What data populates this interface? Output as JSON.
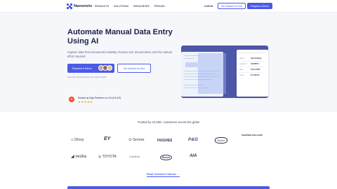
{
  "nav": {
    "brand": "Nanonets",
    "links": [
      "PRODUCTS",
      "SOLUTIONS",
      "RESOURCES",
      "PRICING"
    ],
    "login": "LOG IN",
    "free_button": "Get Started for Free",
    "demo_button": "Request a Demo"
  },
  "hero": {
    "title": "Automate Manual Data Entry Using AI",
    "subtitle": "Capture data from documents instantly. Reduce turn around times and the manual effort required.",
    "demo_button": "Request a Demo",
    "free_button": "Get started for free",
    "free_note": "Free trial. Cancel anytime. No setup charges.",
    "g2_badge": "G",
    "g2_rank": "Ranked as High-Performer on G2 (4.8 of 5)",
    "stars": "★★★★★"
  },
  "invoice_card": {
    "rows": [
      {
        "key": "Name",
        "value": "Jacob Wong"
      },
      {
        "key": "Invoice #",
        "value": "12478974"
      },
      {
        "key": "Date",
        "value": "01-01-2020"
      },
      {
        "key": "Total",
        "value": "$ 1,245.00"
      }
    ]
  },
  "trusted": {
    "heading": "Trusted by 10,000+ customers across the globe",
    "logos_row1": [
      "Divvy",
      "EY",
      "Grover",
      "HUGHES",
      "P&G",
      "Roche",
      "SHERWIN WILLIAMS"
    ],
    "logos_row2": [
      "veolia",
      "TOYOTA",
      "Cardinal",
      "Bosch",
      "AIA"
    ],
    "read_more": "Read Customer Stories →"
  },
  "colors": {
    "accent": "#4b5be6",
    "navy": "#1b2148",
    "hero_bg": "#f6f7fb",
    "illustration": "#4d57a8",
    "g2": "#ff492c",
    "star": "#f2a417"
  }
}
